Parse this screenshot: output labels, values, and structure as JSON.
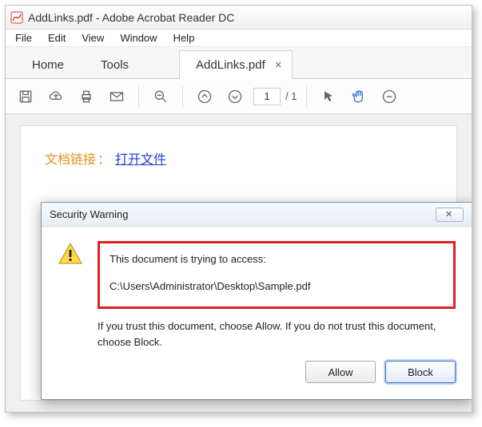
{
  "window": {
    "title": "AddLinks.pdf - Adobe Acrobat Reader DC"
  },
  "menu": {
    "file": "File",
    "edit": "Edit",
    "view": "View",
    "window": "Window",
    "help": "Help"
  },
  "tabs": {
    "home": "Home",
    "tools": "Tools",
    "doc": "AddLinks.pdf",
    "close": "×"
  },
  "toolbar": {
    "page_current": "1",
    "page_total": "/ 1"
  },
  "docbody": {
    "label": "文档链接",
    "colon": "：",
    "link": "打开文件"
  },
  "dialog": {
    "title": "Security Warning",
    "close_glyph": "⧉",
    "line1": "This document is trying to access:",
    "path": "C:\\Users\\Administrator\\Desktop\\Sample.pdf",
    "trust": "If you trust this document, choose Allow. If you do not trust this document, choose Block.",
    "allow": "Allow",
    "block": "Block"
  }
}
